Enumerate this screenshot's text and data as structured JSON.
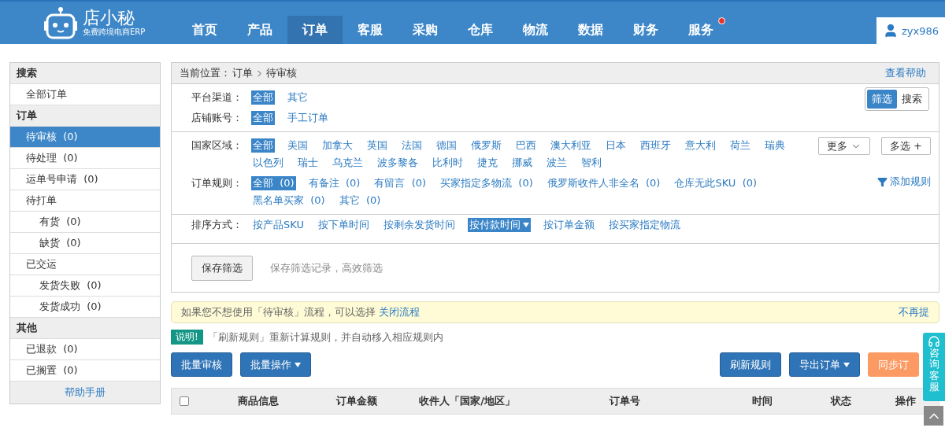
{
  "header": {
    "logo": {
      "name": "店小秘",
      "tagline": "免费跨境电商ERP"
    },
    "nav": [
      {
        "label": "首页",
        "selected": false,
        "badge": false
      },
      {
        "label": "产品",
        "selected": false,
        "badge": false
      },
      {
        "label": "订单",
        "selected": true,
        "badge": false
      },
      {
        "label": "客服",
        "selected": false,
        "badge": false
      },
      {
        "label": "采购",
        "selected": false,
        "badge": false
      },
      {
        "label": "仓库",
        "selected": false,
        "badge": false
      },
      {
        "label": "物流",
        "selected": false,
        "badge": false
      },
      {
        "label": "数据",
        "selected": false,
        "badge": false
      },
      {
        "label": "财务",
        "selected": false,
        "badge": false
      },
      {
        "label": "服务",
        "selected": false,
        "badge": true
      }
    ],
    "user": "zyx986"
  },
  "sidebar": {
    "sections": [
      {
        "title": "搜索",
        "items": [
          {
            "label": "全部订单",
            "selected": false
          }
        ]
      },
      {
        "title": "订单",
        "items": [
          {
            "label": "待审核  (0)",
            "selected": true
          },
          {
            "label": "待处理  (0)",
            "selected": false
          },
          {
            "label": "运单号申请  (0)",
            "selected": false
          },
          {
            "label": "待打单",
            "selected": false,
            "children": [
              {
                "label": "有货  (0)",
                "selected": false
              },
              {
                "label": "缺货  (0)",
                "selected": false
              }
            ]
          },
          {
            "label": "已交运",
            "selected": false,
            "children": [
              {
                "label": "发货失败  (0)",
                "selected": false
              },
              {
                "label": "发货成功  (0)",
                "selected": false
              }
            ]
          }
        ]
      },
      {
        "title": "其他",
        "items": [
          {
            "label": "已退款  (0)",
            "selected": false
          },
          {
            "label": "已搁置  (0)",
            "selected": false
          }
        ]
      }
    ],
    "help": "帮助手册"
  },
  "breadcrumb": {
    "label": "当前位置：",
    "path": [
      "订单",
      "待审核"
    ],
    "help": "查看帮助"
  },
  "mode_toggle": [
    {
      "label": "筛选",
      "selected": true
    },
    {
      "label": "搜索",
      "selected": false
    }
  ],
  "filter_groups": [
    {
      "rows": [
        {
          "label": "平台渠道：",
          "options": [
            {
              "label": "全部",
              "selected": true
            },
            {
              "label": "其它",
              "selected": false
            }
          ]
        },
        {
          "label": "店铺账号：",
          "options": [
            {
              "label": "全部",
              "selected": true
            },
            {
              "label": "手工订单",
              "selected": false
            }
          ]
        }
      ]
    },
    {
      "rows": [
        {
          "label": "国家区域：",
          "options": [
            {
              "label": "全部",
              "selected": true
            },
            {
              "label": "美国",
              "selected": false
            },
            {
              "label": "加拿大",
              "selected": false
            },
            {
              "label": "英国",
              "selected": false
            },
            {
              "label": "法国",
              "selected": false
            },
            {
              "label": "德国",
              "selected": false
            },
            {
              "label": "俄罗斯",
              "selected": false
            },
            {
              "label": "巴西",
              "selected": false
            },
            {
              "label": "澳大利亚",
              "selected": false
            },
            {
              "label": "日本",
              "selected": false
            },
            {
              "label": "西班牙",
              "selected": false
            },
            {
              "label": "意大利",
              "selected": false
            },
            {
              "label": "荷兰",
              "selected": false
            },
            {
              "label": "瑞典",
              "selected": false
            },
            {
              "label": "以色列",
              "selected": false
            },
            {
              "label": "瑞士",
              "selected": false
            },
            {
              "label": "乌克兰",
              "selected": false
            },
            {
              "label": "波多黎各",
              "selected": false
            },
            {
              "label": "比利时",
              "selected": false
            },
            {
              "label": "捷克",
              "selected": false
            },
            {
              "label": "挪威",
              "selected": false
            },
            {
              "label": "波兰",
              "selected": false
            },
            {
              "label": "智利",
              "selected": false
            }
          ],
          "actions": [
            {
              "kind": "more",
              "label": "更多"
            },
            {
              "kind": "multi",
              "label": "多选 +"
            }
          ]
        },
        {
          "label": "订单规则：",
          "options": [
            {
              "label": "全部  (0)",
              "selected": true
            },
            {
              "label": "有备注  (0)",
              "selected": false
            },
            {
              "label": "有留言  (0)",
              "selected": false
            },
            {
              "label": "买家指定多物流  (0)",
              "selected": false
            },
            {
              "label": "俄罗斯收件人非全名  (0)",
              "selected": false
            },
            {
              "label": "仓库无此SKU  (0)",
              "selected": false
            },
            {
              "label": "黑名单买家  (0)",
              "selected": false
            },
            {
              "label": "其它  (0)",
              "selected": false
            }
          ],
          "actions": [
            {
              "kind": "add-rule",
              "label": "添加规则"
            }
          ]
        }
      ]
    }
  ],
  "sort": {
    "label": "排序方式：",
    "options": [
      {
        "label": "按产品SKU",
        "selected": false
      },
      {
        "label": "按下单时间",
        "selected": false
      },
      {
        "label": "按剩余发货时间",
        "selected": false
      },
      {
        "label": "按付款时间",
        "selected": true
      },
      {
        "label": "按订单金额",
        "selected": false
      },
      {
        "label": "按买家指定物流",
        "selected": false
      }
    ]
  },
  "save": {
    "button": "保存筛选",
    "hint": "保存筛选记录，高效筛选"
  },
  "notice": {
    "text": "如果您不想使用「待审核」流程，可以选择",
    "link": "关闭流程",
    "dismiss": "不再提"
  },
  "note": {
    "badge": "说明!",
    "text": "「刷新规则」重新计算规则，并自动移入相应规则内"
  },
  "actions_left": [
    {
      "label": "批量审核",
      "dropdown": false
    },
    {
      "label": "批量操作",
      "dropdown": true
    }
  ],
  "actions_right": [
    {
      "label": "刷新规则",
      "dropdown": false,
      "kind": "primary"
    },
    {
      "label": "导出订单",
      "dropdown": true,
      "kind": "primary"
    },
    {
      "label": "同步订",
      "dropdown": false,
      "kind": "warning"
    }
  ],
  "table": {
    "select_all": {
      "checked": false
    },
    "columns": [
      "商品信息",
      "订单金额",
      "收件人「国家/地区」",
      "订单号",
      "时间",
      "状态",
      "操作"
    ]
  },
  "service_widget": {
    "label": "咨询客服"
  }
}
